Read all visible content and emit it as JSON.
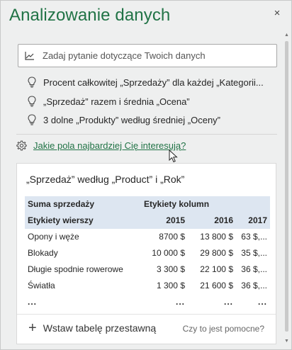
{
  "pane": {
    "title": "Analizowanie danych",
    "close_label": "×"
  },
  "ask": {
    "placeholder": "Zadaj pytanie dotyczące Twoich danych",
    "icon": "line-chart-icon"
  },
  "suggestions": [
    {
      "text": "Procent całkowitej „Sprzedaży” dla każdej „Kategorii...",
      "icon": "lightbulb-icon"
    },
    {
      "text": "„Sprzedaż” razem i średnia „Ocena”",
      "icon": "lightbulb-icon"
    },
    {
      "text": "3 dolne „Produkty” według średniej „Oceny”",
      "icon": "lightbulb-icon"
    }
  ],
  "fields_link": {
    "text": "Jakie pola najbardziej Cię interesują?",
    "icon": "gear-icon"
  },
  "card": {
    "title": "„Sprzedaż” według „Product” i „Rok”",
    "pivot": {
      "values_label": "Suma sprzedaży",
      "column_labels": "Etykiety kolumn",
      "row_labels": "Etykiety wierszy",
      "years": [
        "2015",
        "2016",
        "2017"
      ],
      "rows": [
        {
          "label": "Opony i węże",
          "v2015": "8700 $",
          "v2016": "13 800 $",
          "v2017": "63 $,..."
        },
        {
          "label": "Blokady",
          "v2015": "10 000 $",
          "v2016": "29 800 $",
          "v2017": "35 $,..."
        },
        {
          "label": "Długie spodnie rowerowe",
          "v2015": "3 300 $",
          "v2016": "22 100 $",
          "v2017": "36 $,..."
        },
        {
          "label": "Światła",
          "v2015": "1 300 $",
          "v2016": "21 600 $",
          "v2017": "36 $,..."
        }
      ],
      "ellipsis": "..."
    },
    "insert_label": "Wstaw tabelę przestawną",
    "plus_label": "+",
    "helpful_label": "Czy to jest pomocne?"
  },
  "colors": {
    "accent": "#217346",
    "pivot_header": "#dde6f1"
  }
}
